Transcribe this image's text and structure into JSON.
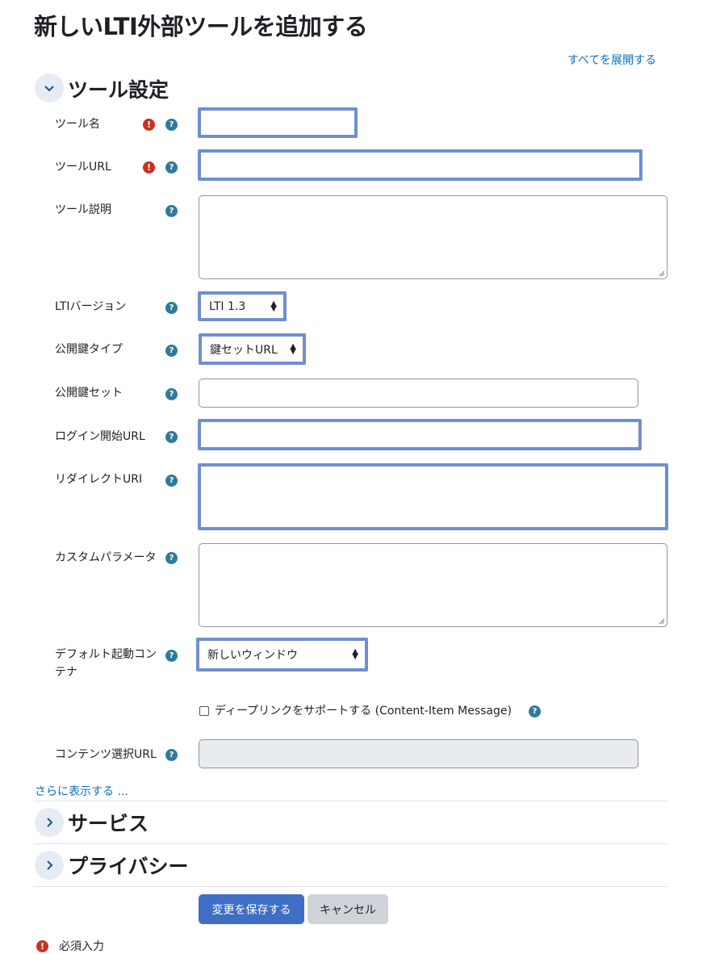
{
  "page_title": "新しいLTI外部ツールを追加する",
  "expand_all": "すべてを展開する",
  "sections": {
    "tool_settings": "ツール設定",
    "services": "サービス",
    "privacy": "プライバシー"
  },
  "fields": {
    "tool_name": {
      "label": "ツール名",
      "value": ""
    },
    "tool_url": {
      "label": "ツールURL",
      "value": ""
    },
    "tool_description": {
      "label": "ツール説明",
      "value": ""
    },
    "lti_version": {
      "label": "LTIバージョン",
      "selected": "LTI 1.3"
    },
    "public_key_type": {
      "label": "公開鍵タイプ",
      "selected": "鍵セットURL"
    },
    "public_keyset": {
      "label": "公開鍵セット",
      "value": ""
    },
    "login_url": {
      "label": "ログイン開始URL",
      "value": ""
    },
    "redirect_uri": {
      "label": "リダイレクトURI",
      "value": ""
    },
    "custom_params": {
      "label": "カスタムパラメータ",
      "value": ""
    },
    "default_container": {
      "label_line1": "デフォルト起動コン",
      "label_line2": "テナ",
      "selected": "新しいウィンドウ"
    },
    "deep_linking": {
      "label": "ディープリンクをサポートする (Content-Item Message)",
      "checked": false
    },
    "content_selection_url": {
      "label": "コンテンツ選択URL",
      "value": ""
    }
  },
  "show_more": "さらに表示する ...",
  "buttons": {
    "save": "変更を保存する",
    "cancel": "キャンセル"
  },
  "required_note": "必須入力",
  "icons": {
    "required": "exclamation-icon",
    "help": "question-icon"
  },
  "colors": {
    "link": "#0f6cbf",
    "primary": "#3f6fc4",
    "required": "#ca3120",
    "help": "#2f7a9c",
    "focus": "#6f8fcf"
  }
}
